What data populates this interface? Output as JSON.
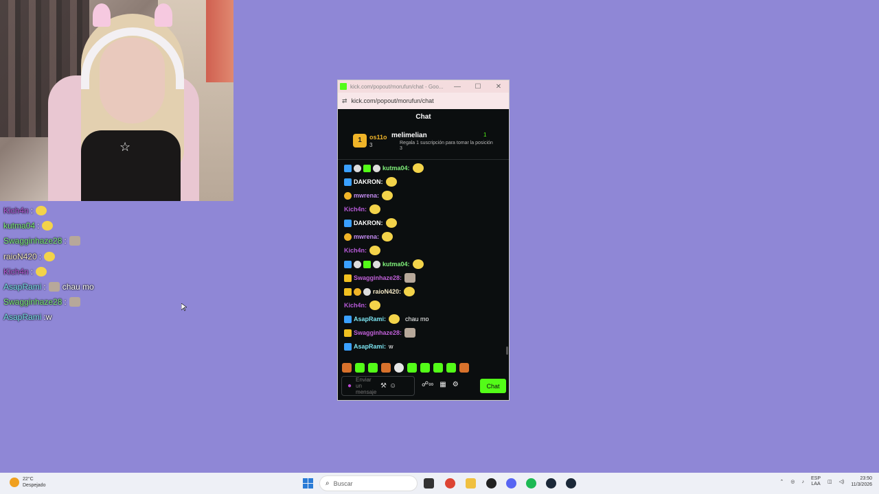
{
  "overlay_chat": [
    {
      "user": "Kich4n",
      "sep": " : ",
      "text": "",
      "color": "#b75ad8"
    },
    {
      "user": "kutma04",
      "sep": " : ",
      "text": "",
      "color": "#7ff07a"
    },
    {
      "user": "Swagginhaze28",
      "sep": " : ",
      "text": "",
      "color": "#7ff07a"
    },
    {
      "user": "raioN420",
      "sep": " : ",
      "text": "",
      "color": "#f3e7c4"
    },
    {
      "user": "Kich4n",
      "sep": " : ",
      "text": "",
      "color": "#b75ad8"
    },
    {
      "user": "AsapRami",
      "sep": " : ",
      "text": "chau mo",
      "color": "#7be3f0"
    },
    {
      "user": "Swagginhaze28",
      "sep": " : ",
      "text": "",
      "color": "#7ff07a"
    },
    {
      "user": "AsapRami",
      "sep": " : ",
      "text": "w",
      "color": "#7be3f0"
    }
  ],
  "browser": {
    "title": "kick.com/popout/morufun/chat - Goo...",
    "url": "kick.com/popout/morufun/chat",
    "minimize": "—",
    "maximize": "☐",
    "close": "✕"
  },
  "chat": {
    "header": "Chat",
    "pinned": {
      "rank": "1",
      "top_user": "os11o",
      "top_count": "3",
      "gifter": "melimelian",
      "gifter_count": "1",
      "gift_text": "Regala 1 suscripción para tomar la posición 3"
    },
    "messages": [
      {
        "user": "kutma04",
        "text": "",
        "color": "#7ff07a",
        "badges": [
          "b-blue",
          "b-white",
          "b-green",
          "b-white"
        ]
      },
      {
        "user": "DAKRON",
        "text": "",
        "color": "#ffffff",
        "badges": [
          "b-blue"
        ]
      },
      {
        "user": "mwrena",
        "text": "",
        "color": "#c38bf0",
        "badges": [
          "b-gold"
        ]
      },
      {
        "user": "Kich4n",
        "text": "",
        "color": "#b75ad8",
        "badges": []
      },
      {
        "user": "DAKRON",
        "text": "",
        "color": "#ffffff",
        "badges": [
          "b-blue"
        ]
      },
      {
        "user": "mwrena",
        "text": "",
        "color": "#c38bf0",
        "badges": [
          "b-gold"
        ]
      },
      {
        "user": "Kich4n",
        "text": "",
        "color": "#b75ad8",
        "badges": []
      },
      {
        "user": "kutma04",
        "text": "",
        "color": "#7ff07a",
        "badges": [
          "b-blue",
          "b-white",
          "b-green",
          "b-white"
        ]
      },
      {
        "user": "Swagginhaze28",
        "text": "",
        "color": "#c060d8",
        "badges": [
          "b-crown"
        ]
      },
      {
        "user": "raioN420",
        "text": "",
        "color": "#f3e7c4",
        "badges": [
          "b-crown",
          "b-gold",
          "b-white"
        ]
      },
      {
        "user": "Kich4n",
        "text": "",
        "color": "#b75ad8",
        "badges": []
      },
      {
        "user": "AsapRami",
        "text": "chau mo",
        "color": "#7be3f0",
        "badges": [
          "b-blue"
        ]
      },
      {
        "user": "Swagginhaze28",
        "text": "",
        "color": "#c060d8",
        "badges": [
          "b-crown"
        ]
      },
      {
        "user": "AsapRami",
        "text": "w",
        "color": "#7be3f0",
        "badges": [
          "b-blue"
        ]
      }
    ],
    "input_placeholder": "Enviar un mensaje",
    "send_label": "Chat"
  },
  "taskbar": {
    "temperature": "22°C",
    "weather": "Despejado",
    "search_placeholder": "Buscar",
    "lang_1": "ESP",
    "lang_2": "LAA",
    "time": "23:50",
    "date": "11/3/2026"
  }
}
